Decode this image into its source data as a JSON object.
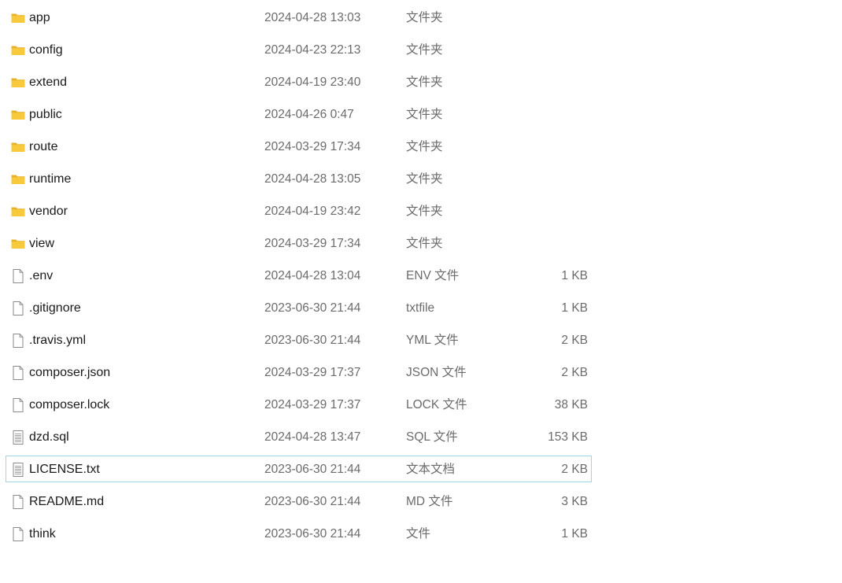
{
  "files": [
    {
      "name": "app",
      "modified": "2024-04-28 13:03",
      "type": "文件夹",
      "size": "",
      "icon": "folder-icon"
    },
    {
      "name": "config",
      "modified": "2024-04-23 22:13",
      "type": "文件夹",
      "size": "",
      "icon": "folder-icon"
    },
    {
      "name": "extend",
      "modified": "2024-04-19 23:40",
      "type": "文件夹",
      "size": "",
      "icon": "folder-icon"
    },
    {
      "name": "public",
      "modified": "2024-04-26 0:47",
      "type": "文件夹",
      "size": "",
      "icon": "folder-icon"
    },
    {
      "name": "route",
      "modified": "2024-03-29 17:34",
      "type": "文件夹",
      "size": "",
      "icon": "folder-icon"
    },
    {
      "name": "runtime",
      "modified": "2024-04-28 13:05",
      "type": "文件夹",
      "size": "",
      "icon": "folder-icon"
    },
    {
      "name": "vendor",
      "modified": "2024-04-19 23:42",
      "type": "文件夹",
      "size": "",
      "icon": "folder-icon"
    },
    {
      "name": "view",
      "modified": "2024-03-29 17:34",
      "type": "文件夹",
      "size": "",
      "icon": "folder-icon"
    },
    {
      "name": ".env",
      "modified": "2024-04-28 13:04",
      "type": "ENV 文件",
      "size": "1 KB",
      "icon": "file-icon"
    },
    {
      "name": ".gitignore",
      "modified": "2023-06-30 21:44",
      "type": "txtfile",
      "size": "1 KB",
      "icon": "file-icon"
    },
    {
      "name": ".travis.yml",
      "modified": "2023-06-30 21:44",
      "type": "YML 文件",
      "size": "2 KB",
      "icon": "file-icon"
    },
    {
      "name": "composer.json",
      "modified": "2024-03-29 17:37",
      "type": "JSON 文件",
      "size": "2 KB",
      "icon": "file-icon"
    },
    {
      "name": "composer.lock",
      "modified": "2024-03-29 17:37",
      "type": "LOCK 文件",
      "size": "38 KB",
      "icon": "file-icon"
    },
    {
      "name": "dzd.sql",
      "modified": "2024-04-28 13:47",
      "type": "SQL 文件",
      "size": "153 KB",
      "icon": "text-document-icon"
    },
    {
      "name": "LICENSE.txt",
      "modified": "2023-06-30 21:44",
      "type": "文本文档",
      "size": "2 KB",
      "icon": "text-document-icon",
      "focused": true
    },
    {
      "name": "README.md",
      "modified": "2023-06-30 21:44",
      "type": "MD 文件",
      "size": "3 KB",
      "icon": "file-icon"
    },
    {
      "name": "think",
      "modified": "2023-06-30 21:44",
      "type": "文件",
      "size": "1 KB",
      "icon": "file-icon"
    }
  ],
  "colors": {
    "folder": "#f8c93b",
    "focus_border": "#9fd4ea",
    "secondary_text": "#6b6b6b"
  }
}
